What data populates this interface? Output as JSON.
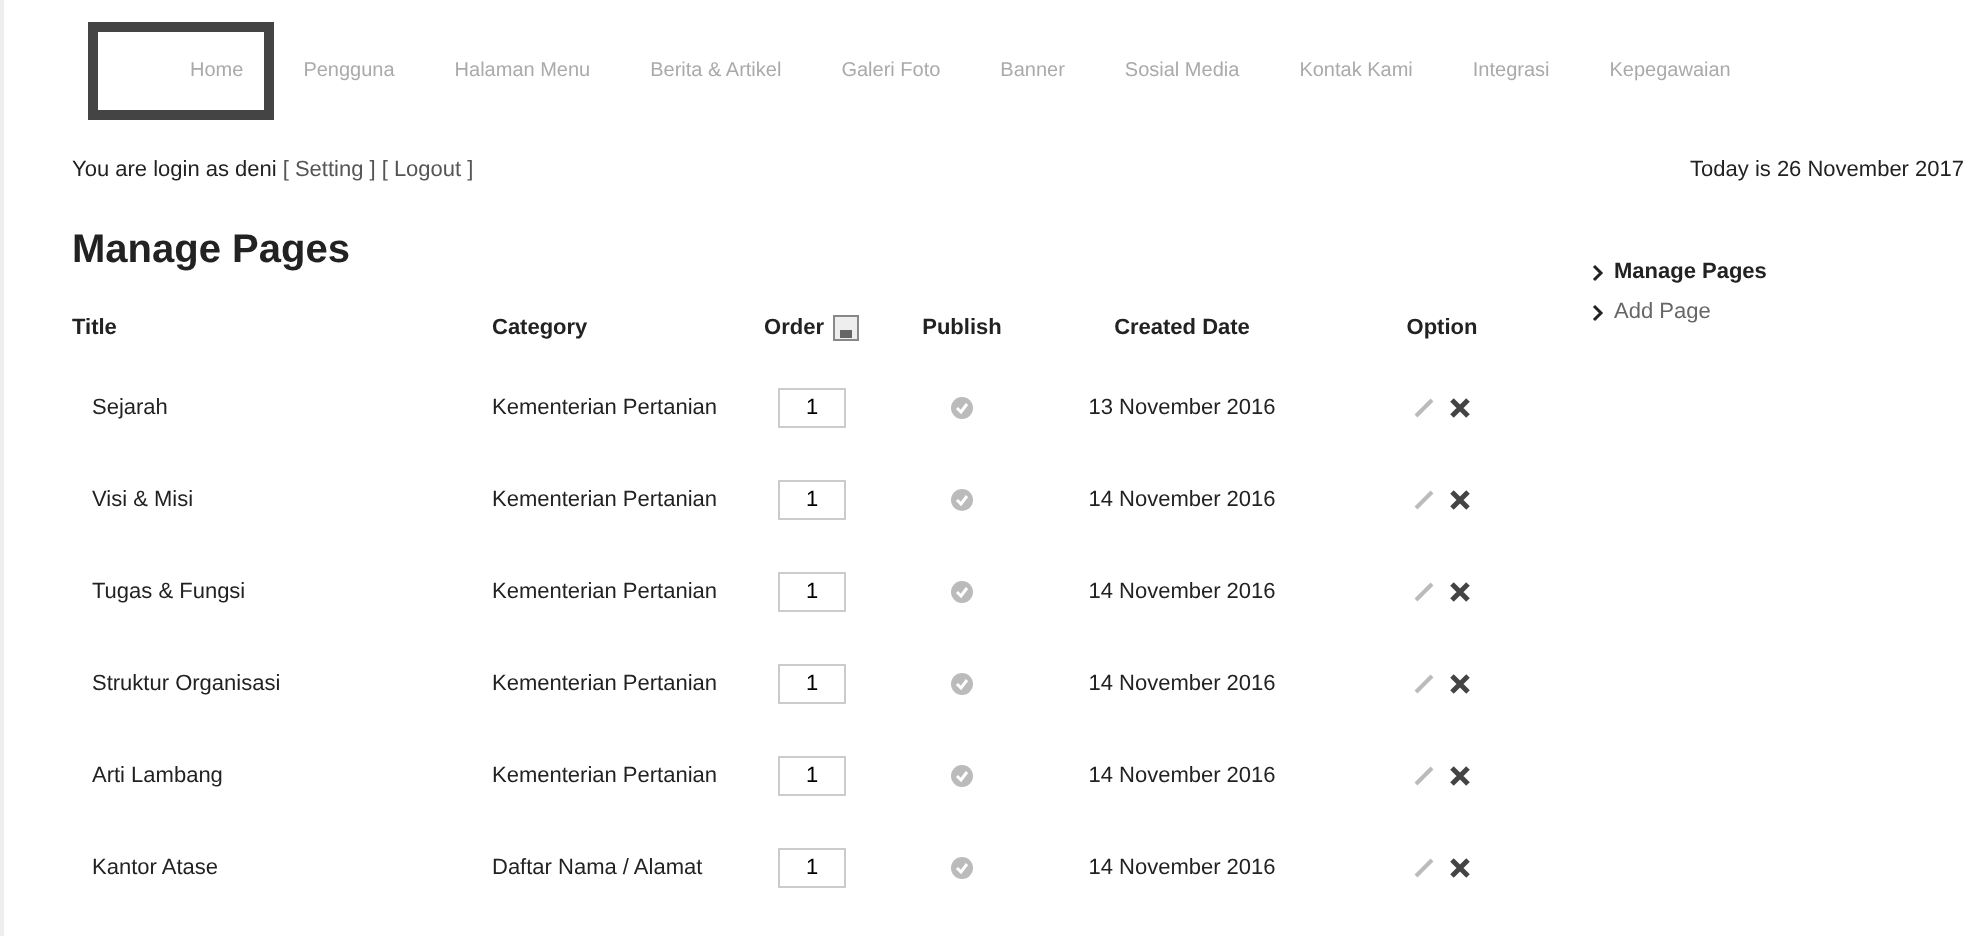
{
  "nav": [
    {
      "label": "Home",
      "selected": true
    },
    {
      "label": "Pengguna",
      "selected": false
    },
    {
      "label": "Halaman Menu",
      "selected": false
    },
    {
      "label": "Berita & Artikel",
      "selected": false
    },
    {
      "label": "Galeri Foto",
      "selected": false
    },
    {
      "label": "Banner",
      "selected": false
    },
    {
      "label": "Sosial Media",
      "selected": false
    },
    {
      "label": "Kontak Kami",
      "selected": false
    },
    {
      "label": "Integrasi",
      "selected": false
    },
    {
      "label": "Kepegawaian",
      "selected": false
    }
  ],
  "login": {
    "text": "You are login as deni",
    "links": [
      "[ Setting ]",
      "[ Logout ]"
    ]
  },
  "today": "Today is 26 November 2017",
  "heading": "Manage Pages",
  "columns": [
    "Title",
    "Category",
    "Order",
    "Publish",
    "Created Date",
    "Option"
  ],
  "rows": [
    {
      "title": "Sejarah",
      "category": "Kementerian Pertanian",
      "order": "1",
      "date": "13 November 2016"
    },
    {
      "title": "Visi & Misi",
      "category": "Kementerian Pertanian",
      "order": "1",
      "date": "14 November 2016"
    },
    {
      "title": "Tugas & Fungsi",
      "category": "Kementerian Pertanian",
      "order": "1",
      "date": "14 November 2016"
    },
    {
      "title": "Struktur Organisasi",
      "category": "Kementerian Pertanian",
      "order": "1",
      "date": "14 November 2016"
    },
    {
      "title": "Arti Lambang",
      "category": "Kementerian Pertanian",
      "order": "1",
      "date": "14 November 2016"
    },
    {
      "title": "Kantor Atase",
      "category": "Daftar Nama / Alamat",
      "order": "1",
      "date": "14 November 2016"
    }
  ],
  "sidebar": [
    {
      "label": "Manage Pages",
      "selected": true
    },
    {
      "label": "Add Page",
      "selected": false
    }
  ]
}
